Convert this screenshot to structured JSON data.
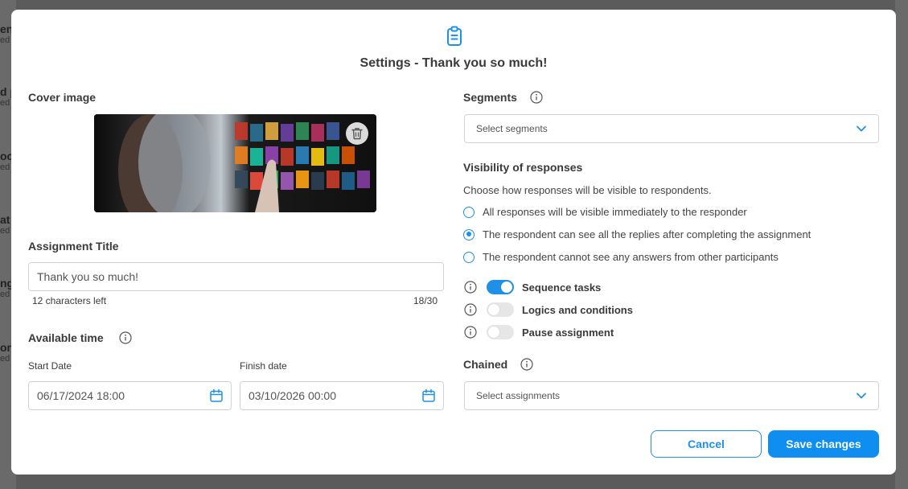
{
  "background_list": [
    {
      "title": "en",
      "sub": "ed"
    },
    {
      "title": "d p",
      "sub": "ed"
    },
    {
      "title": "oct",
      "sub": "ed"
    },
    {
      "title": "at",
      "sub": "ed"
    },
    {
      "title": "ng",
      "sub": "ed"
    },
    {
      "title": "on",
      "sub": "ed"
    }
  ],
  "modal": {
    "title": "Settings - Thank you so much!",
    "cover_label": "Cover image",
    "assignment_title_label": "Assignment Title",
    "assignment_title_value": "Thank you so much!",
    "chars_left": "12 characters left",
    "char_count": "18/30",
    "available_time_label": "Available time",
    "start_date_label": "Start Date",
    "start_date_value": "06/17/2024 18:00",
    "finish_date_label": "Finish date",
    "finish_date_value": "03/10/2026 00:00",
    "segments_label": "Segments",
    "segments_placeholder": "Select segments",
    "visibility_label": "Visibility of responses",
    "visibility_desc": "Choose how responses will be visible to respondents.",
    "visibility_options": [
      {
        "label": "All responses will be visible immediately to the responder",
        "selected": false
      },
      {
        "label": "The respondent can see all the replies after completing the assignment",
        "selected": true
      },
      {
        "label": "The respondent cannot see any answers from other participants",
        "selected": false
      }
    ],
    "toggles": [
      {
        "label": "Sequence tasks",
        "on": true
      },
      {
        "label": "Logics and conditions",
        "on": false
      },
      {
        "label": "Pause assignment",
        "on": false
      }
    ],
    "chained_label": "Chained",
    "chained_placeholder": "Select assignments",
    "cancel_label": "Cancel",
    "save_label": "Save changes",
    "accent_color": "#1e90e8"
  }
}
